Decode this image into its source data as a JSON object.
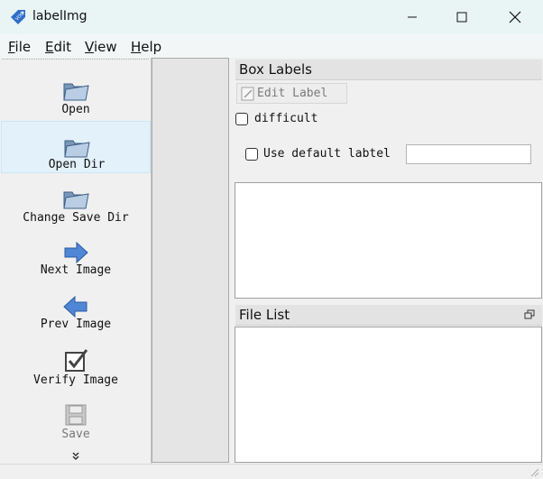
{
  "window": {
    "title": "labelImg",
    "icon": "voc-tag-icon",
    "icon_text": "VOC"
  },
  "window_controls": [
    "minimize",
    "maximize",
    "close"
  ],
  "menubar": {
    "items": [
      {
        "mnemonic": "F",
        "rest": "ile"
      },
      {
        "mnemonic": "E",
        "rest": "dit"
      },
      {
        "mnemonic": "V",
        "rest": "iew"
      },
      {
        "mnemonic": "H",
        "rest": "elp"
      }
    ]
  },
  "toolbar": {
    "items": [
      {
        "label": "Open",
        "icon": "folder-icon"
      },
      {
        "label": "Open Dir",
        "icon": "folder-icon"
      },
      {
        "label": "Change Save Dir",
        "icon": "folder-icon"
      },
      {
        "label": "Next Image",
        "icon": "arrow-right-icon"
      },
      {
        "label": "Prev Image",
        "icon": "arrow-left-icon"
      },
      {
        "label": "Verify Image",
        "icon": "check-box-icon"
      },
      {
        "label": "Save",
        "icon": "floppy-icon",
        "enabled": false
      }
    ],
    "more_icon": "double-chevron-down-icon"
  },
  "box_labels": {
    "title": "Box Labels",
    "edit_label": "Edit Label",
    "difficult": "difficult",
    "use_default_label": "Use default labtel",
    "default_label_value": ""
  },
  "file_list": {
    "title": "File List"
  },
  "colors": {
    "titlebar": "#e9f4f5",
    "accent_icon": "#3a7bd5",
    "highlight": "#e3f1fb"
  }
}
